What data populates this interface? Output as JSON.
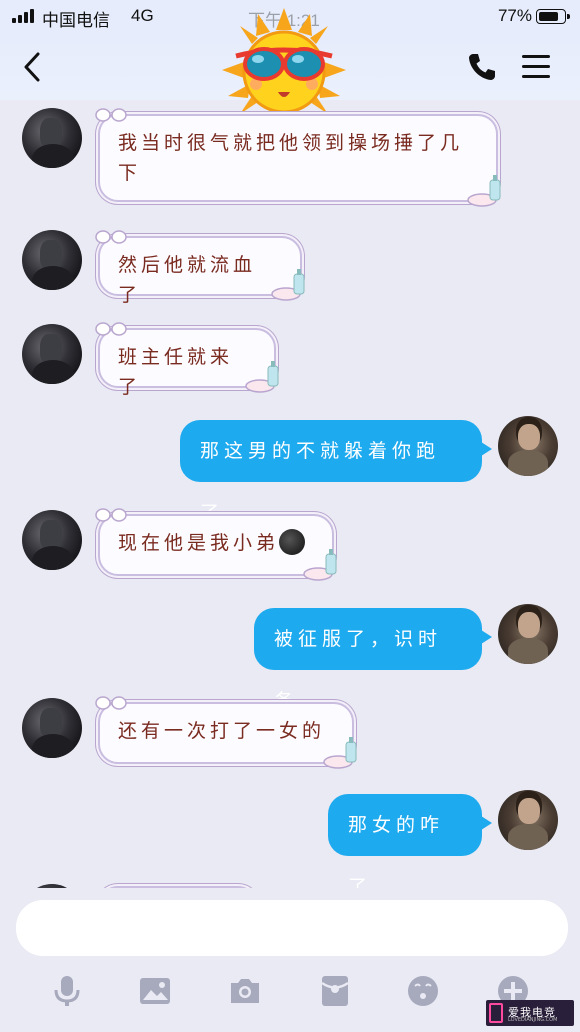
{
  "status_bar": {
    "carrier": "中国电信",
    "network": "4G",
    "time": "下午 1:21",
    "battery": "77%"
  },
  "messages": [
    {
      "side": "left",
      "text": "我当时很气就把他领到操场捶了几下"
    },
    {
      "side": "left",
      "text": "然后他就流血了"
    },
    {
      "side": "left",
      "text": "班主任就来了"
    },
    {
      "side": "right",
      "text": "那这男的不就躲着你跑了"
    },
    {
      "side": "left",
      "text": "现在他是我小弟",
      "emoji": "new-moon-face"
    },
    {
      "side": "right",
      "text": "被征服了，识时务"
    },
    {
      "side": "left",
      "text": "还有一次打了一女的"
    },
    {
      "side": "right",
      "text": "那女的咋了"
    }
  ],
  "icons": {
    "nav": [
      "back-arrow",
      "sunglasses-sun",
      "phone",
      "menu"
    ],
    "toolbar": [
      "microphone",
      "image",
      "camera",
      "red-packet",
      "emoji",
      "plus"
    ]
  },
  "colors": {
    "self_bubble": "#1eaaef",
    "other_text": "#7a2b20",
    "background": "#e9eaf3"
  },
  "watermark": {
    "brand": "爱我电竞",
    "site": "LOVEDIANJING.COM"
  }
}
